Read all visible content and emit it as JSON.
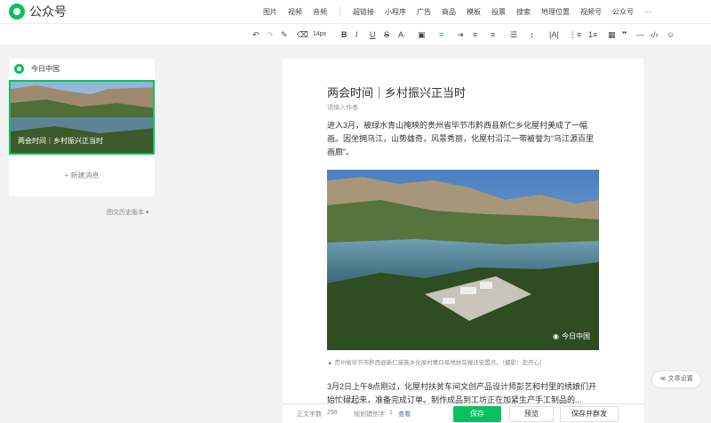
{
  "app": {
    "title": "公众号"
  },
  "topnav": {
    "items": [
      "图片",
      "视频",
      "音频",
      "超链接",
      "小程序",
      "广告",
      "商品",
      "模板",
      "投票",
      "搜索",
      "地理位置",
      "视频号",
      "公众号",
      "···"
    ]
  },
  "toolbar": {
    "font_size": "14px",
    "buttons": [
      "undo-icon",
      "redo-icon",
      "format-painter-icon",
      "clear-format-icon",
      "bold-icon",
      "italic-icon",
      "underline-icon",
      "strikethrough-icon",
      "font-color-icon",
      "bg-color-icon",
      "align-left-icon",
      "indent-icon",
      "align-center-icon",
      "align-right-icon",
      "justify-icon",
      "line-height-icon",
      "letter-spacing-icon",
      "list-icon",
      "ordered-list-icon",
      "table-icon",
      "quote-icon",
      "divider-icon",
      "code-icon",
      "emoji-icon"
    ]
  },
  "left": {
    "account": "今日中国",
    "thumb_caption": "两会时间｜乡村振兴正当时",
    "new_message": "+ 新建消息",
    "history": "图文历史版本 ▾"
  },
  "article": {
    "title": "两会时间｜乡村振兴正当时",
    "author_placeholder": "请输入作者",
    "paragraph1": "进入3月，被绿水青山掩映的贵州省毕节市黔西县新仁乡化屋村美成了一幅画。因坐拥乌江，山势雄奇，风景秀丽，化屋村沿江一带被誉为“乌江源百里画廊”。",
    "watermark": "今日中国",
    "caption": "▲ 贵州省毕节市黔西县新仁苗族乡化屋村菁口易地扶贫搬迁安置点。（摄影：史开心）",
    "paragraph2": "3月2日上午8点刚过，化屋村扶贫车间文创产品设计师彭艺和村里的绣娘们开始忙碌起来，准备完成订单。制作成品到工坊正在加紧生产手工制品的..."
  },
  "bottom": {
    "word_count_label": "正文字数",
    "word_count": "298",
    "draft_label": "规划错别字",
    "draft_count": "1",
    "view": "查看",
    "save": "保存",
    "preview": "预览",
    "publish": "保存并群发"
  },
  "settings": "≪ 文章设置",
  "colors": {
    "accent": "#07c160"
  }
}
